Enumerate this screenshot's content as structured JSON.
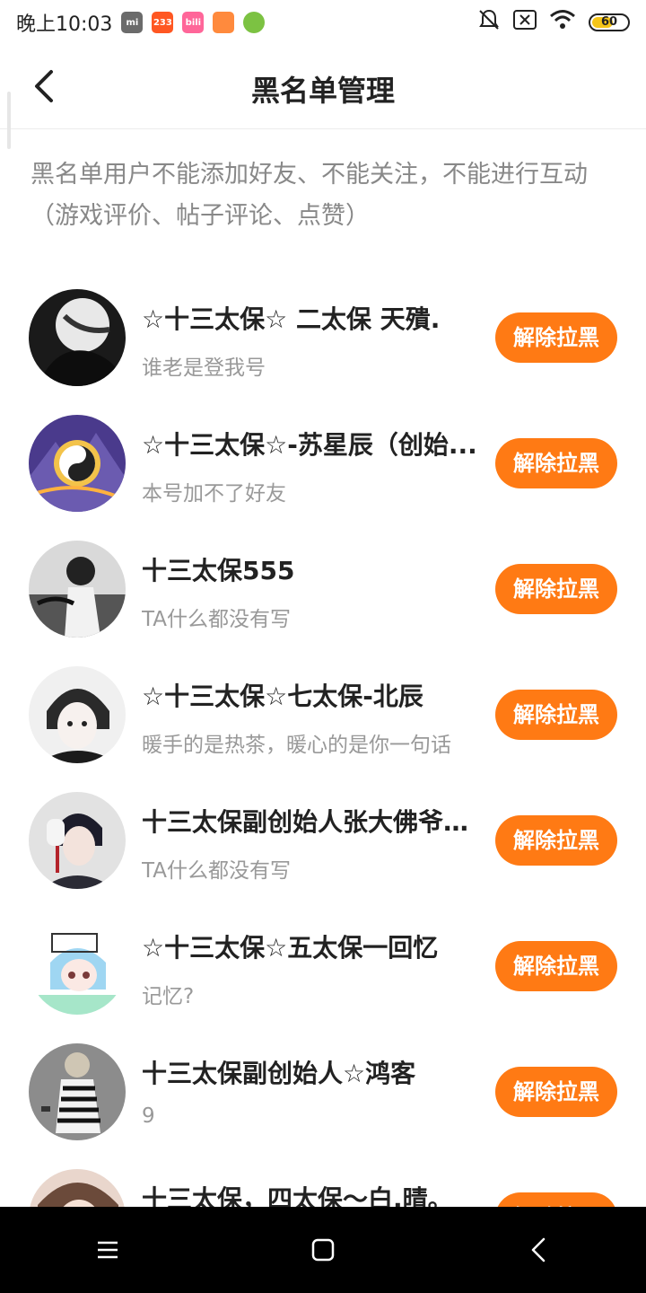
{
  "status_bar": {
    "time": "晚上10:03",
    "app_icons": [
      {
        "name": "mi-icon",
        "label": "mi",
        "color": "#6b6b6b"
      },
      {
        "name": "233-icon",
        "label": "233",
        "color": "#ff5722"
      },
      {
        "name": "bilibili-icon",
        "label": "bili",
        "color": "#ff6699"
      },
      {
        "name": "orange-app-icon",
        "label": "",
        "color": "#ff8a3d"
      },
      {
        "name": "green-app-icon",
        "label": "",
        "color": "#7cc242"
      }
    ],
    "battery_level": "60",
    "battery_fraction": 0.6
  },
  "header": {
    "title": "黑名单管理",
    "back_icon": "chevron-left-icon"
  },
  "notice": "黑名单用户不能添加好友、不能关注，不能进行互动（游戏评价、帖子评论、点赞）",
  "users": [
    {
      "name": "☆十三太保☆ 二太保 天殨.",
      "bio": "谁老是登我号",
      "button": "解除拉黑"
    },
    {
      "name": "☆十三太保☆-苏星辰（创始...",
      "bio": "本号加不了好友",
      "button": "解除拉黑"
    },
    {
      "name": "十三太保555",
      "bio": "TA什么都没有写",
      "button": "解除拉黑"
    },
    {
      "name": "☆十三太保☆七太保-北辰",
      "bio": "暖手的是热茶，暖心的是你一句话",
      "button": "解除拉黑"
    },
    {
      "name": "十三太保副创始人张大佛爷九...",
      "bio": "TA什么都没有写",
      "button": "解除拉黑"
    },
    {
      "name": "☆十三太保☆五太保一回忆",
      "bio": "记忆?",
      "button": "解除拉黑"
    },
    {
      "name": "十三太保副创始人☆鸿客",
      "bio": "9",
      "button": "解除拉黑"
    },
    {
      "name": "十三太保，四太保～白.晴。",
      "bio": "",
      "button": "解除拉黑"
    }
  ],
  "colors": {
    "accent": "#ff7a14",
    "title_text": "#222222",
    "secondary_text": "#999999",
    "nav_bar": "#000000"
  },
  "nav_bar": {
    "menu_icon": "menu-icon",
    "home_icon": "home-square-icon",
    "back_icon": "back-triangle-icon"
  }
}
